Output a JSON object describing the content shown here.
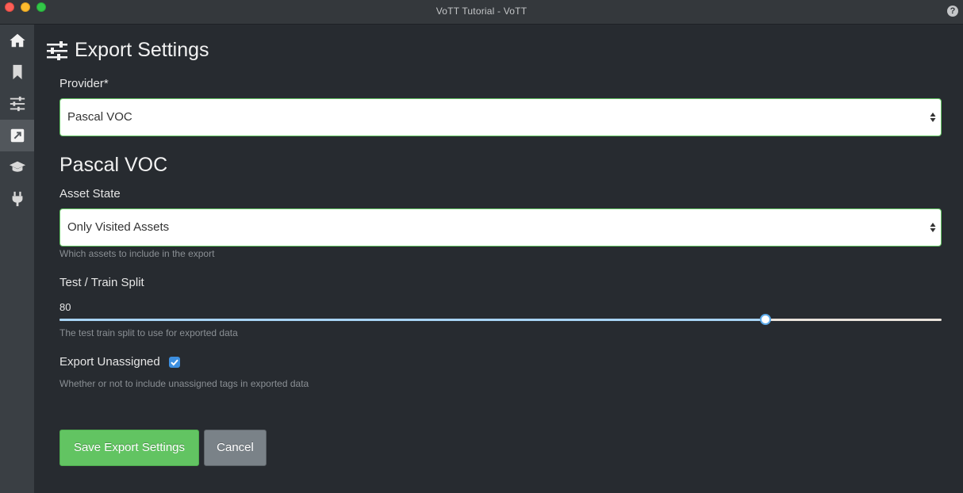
{
  "window": {
    "title": "VoTT Tutorial - VoTT"
  },
  "sidebar": {
    "items": [
      {
        "icon": "home-icon",
        "active": false
      },
      {
        "icon": "bookmark-icon",
        "active": false
      },
      {
        "icon": "sliders-icon",
        "active": false
      },
      {
        "icon": "export-icon",
        "active": true
      },
      {
        "icon": "graduation-cap-icon",
        "active": false
      },
      {
        "icon": "plug-icon",
        "active": false
      }
    ]
  },
  "page": {
    "title": "Export Settings",
    "provider": {
      "label": "Provider*",
      "value": "Pascal VOC"
    },
    "section_title": "Pascal VOC",
    "asset_state": {
      "label": "Asset State",
      "value": "Only Visited Assets",
      "help": "Which assets to include in the export"
    },
    "split": {
      "label": "Test / Train Split",
      "value": "80",
      "value_num": 80,
      "help": "The test train split to use for exported data"
    },
    "export_unassigned": {
      "label": "Export Unassigned",
      "checked": true,
      "help": "Whether or not to include unassigned tags in exported data"
    },
    "buttons": {
      "save": "Save Export Settings",
      "cancel": "Cancel"
    }
  },
  "colors": {
    "accent_success": "#62c462",
    "accent_primary": "#3d8fe0",
    "background": "#272b30",
    "sidebar": "#3a3f44"
  }
}
